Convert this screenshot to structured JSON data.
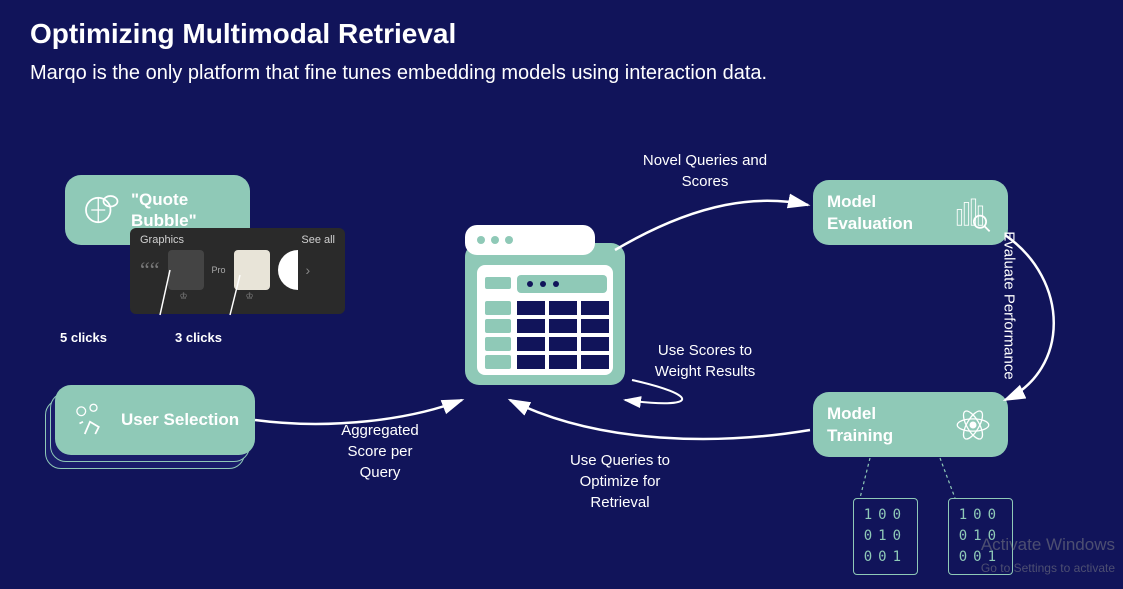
{
  "title": "Optimizing Multimodal Retrieval",
  "subtitle": "Marqo is the only platform that fine tunes embedding models using interaction data.",
  "cards": {
    "quote": "\"Quote Bubble\"",
    "user": "User Selection",
    "eval": "Model Evaluation",
    "train": "Model Training"
  },
  "graphics": {
    "header": "Graphics",
    "seeall": "See all",
    "pro": "Pro"
  },
  "clicks": {
    "five": "5 clicks",
    "three": "3 clicks"
  },
  "labels": {
    "novel": "Novel Queries and Scores",
    "scores": "Use Scores to Weight Results",
    "aggr": "Aggregated Score per Query",
    "queries": "Use Queries to Optimize for Retrieval",
    "perf": "Evaluate Performance"
  },
  "matrices": {
    "m1": [
      [
        "1",
        "0",
        "0"
      ],
      [
        "0",
        "1",
        "0"
      ],
      [
        "0",
        "0",
        "1"
      ]
    ],
    "m2": [
      [
        "1",
        "0",
        "0"
      ],
      [
        "0",
        "1",
        "0"
      ],
      [
        "0",
        "0",
        "1"
      ]
    ]
  },
  "watermark": {
    "l1": "Activate Windows",
    "l2": "Go to Settings to activate"
  }
}
